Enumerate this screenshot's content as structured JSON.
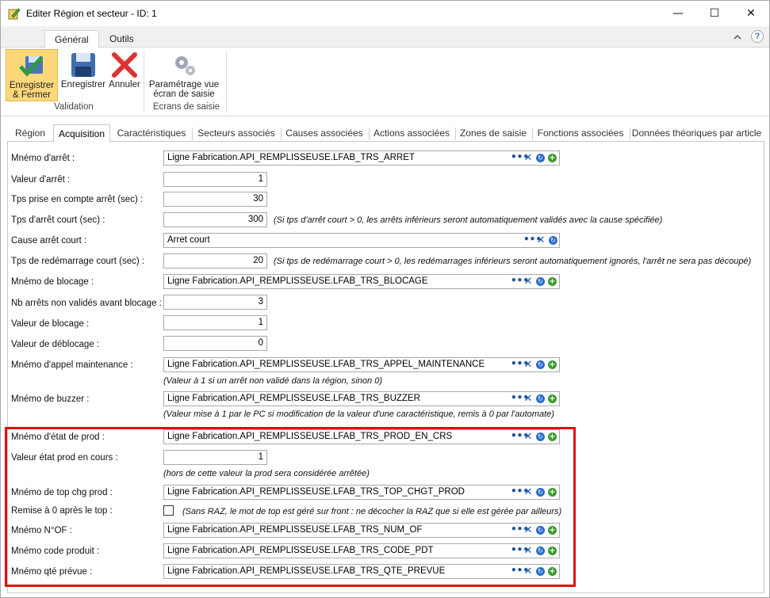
{
  "window": {
    "title": "Editer Région et secteur - ID: 1",
    "icon": "edit-pencil-icon",
    "controls": {
      "minimize": "—",
      "maximize": "☐",
      "close": "✕"
    }
  },
  "ribbon": {
    "tabs": [
      {
        "label": "Général"
      },
      {
        "label": "Outils"
      }
    ],
    "collapse_icon": "chevron-up-icon",
    "help_glyph": "?",
    "groups": {
      "validation": {
        "label": "Validation",
        "buttons": {
          "save_close": {
            "line1": "Enregistrer",
            "line2": "& Fermer",
            "icon": "save-close-icon"
          },
          "save": {
            "label": "Enregistrer",
            "icon": "floppy-disk-icon"
          },
          "cancel": {
            "label": "Annuler",
            "icon": "red-x-icon"
          }
        }
      },
      "screens": {
        "label": "Ecrans de saisie",
        "buttons": {
          "settings": {
            "line1": "Paramétrage vue",
            "line2": "écran de saisie",
            "icon": "gears-icon"
          }
        }
      }
    }
  },
  "page_tabs": [
    {
      "label": "Région"
    },
    {
      "label": "Acquisition"
    },
    {
      "label": "Caractéristiques"
    },
    {
      "label": "Secteurs associés"
    },
    {
      "label": "Causes associées"
    },
    {
      "label": "Actions associées"
    },
    {
      "label": "Zones de saisie"
    },
    {
      "label": "Fonctions associées"
    },
    {
      "label": "Données théoriques par article"
    }
  ],
  "form": {
    "mnemo_arret": {
      "label": "Mnémo d'arrêt :",
      "value": "Ligne Fabrication.API_REMPLISSEUSE.LFAB_TRS_ARRET"
    },
    "valeur_arret": {
      "label": "Valeur d'arrêt :",
      "value": "1"
    },
    "tps_prise": {
      "label": "Tps prise en compte arrêt (sec) :",
      "value": "30"
    },
    "tps_arret_court": {
      "label": "Tps d'arrêt court (sec) :",
      "value": "300",
      "note": "(Si tps d'arrêt court > 0, les arrêts inférieurs seront automatiquement validés avec la cause spécifiée)"
    },
    "cause_arret_court": {
      "label": "Cause arrêt court :",
      "value": "Arret court"
    },
    "tps_redemarrage": {
      "label": "Tps de redémarrage court (sec) :",
      "value": "20",
      "note": "(Si tps de redémarrage court > 0, les redémarrages inférieurs seront automatiquement ignorés, l'arrêt ne sera pas découpé)"
    },
    "mnemo_blocage": {
      "label": "Mnémo de blocage :",
      "value": "Ligne Fabrication.API_REMPLISSEUSE.LFAB_TRS_BLOCAGE"
    },
    "nb_arrets": {
      "label": "Nb arrêts non validés avant blocage :",
      "value": "3"
    },
    "valeur_blocage": {
      "label": "Valeur de blocage :",
      "value": "1"
    },
    "valeur_deblocage": {
      "label": "Valeur de déblocage :",
      "value": "0"
    },
    "mnemo_appel": {
      "label": "Mnémo d'appel maintenance :",
      "value": "Ligne Fabrication.API_REMPLISSEUSE.LFAB_TRS_APPEL_MAINTENANCE",
      "note": "(Valeur à 1 si un arrêt non validé dans la région, sinon 0)"
    },
    "mnemo_buzzer": {
      "label": "Mnémo de buzzer :",
      "value": "Ligne Fabrication.API_REMPLISSEUSE.LFAB_TRS_BUZZER",
      "note": "(Valeur mise à 1 par le PC si modification de la valeur d'une caractéristique, remis à 0 par l'automate)"
    },
    "mnemo_etat_prod": {
      "label": "Mnémo d'état de prod :",
      "value": "Ligne Fabrication.API_REMPLISSEUSE.LFAB_TRS_PROD_EN_CRS"
    },
    "valeur_etat_prod": {
      "label": "Valeur état prod en cours :",
      "value": "1",
      "note": "(hors de cette valeur la prod sera considérée arrêtée)"
    },
    "mnemo_top_chg": {
      "label": "Mnémo de top chg prod :",
      "value": "Ligne Fabrication.API_REMPLISSEUSE.LFAB_TRS_TOP_CHGT_PROD"
    },
    "remise_zero": {
      "label": "Remise à 0 après le top :",
      "checked": false,
      "note": "(Sans RAZ, le mot de top est géré sur front : ne décocher la RAZ que si elle est gérée par ailleurs)"
    },
    "mnemo_num_of": {
      "label": "Mnémo N°OF :",
      "value": "Ligne Fabrication.API_REMPLISSEUSE.LFAB_TRS_NUM_OF"
    },
    "mnemo_code_produit": {
      "label": "Mnémo code produit :",
      "value": "Ligne Fabrication.API_REMPLISSEUSE.LFAB_TRS_CODE_PDT"
    },
    "mnemo_qte_prevue": {
      "label": "Mnémo qté prévue :",
      "value": "Ligne Fabrication.API_REMPLISSEUSE.LFAB_TRS_QTE_PREVUE"
    }
  },
  "field_icons": {
    "browse": "•••",
    "clear": "✕",
    "refresh": "↻",
    "add": "+"
  },
  "colors": {
    "highlight_border": "#e01010",
    "ribbon_selected": "#fdd87a"
  }
}
